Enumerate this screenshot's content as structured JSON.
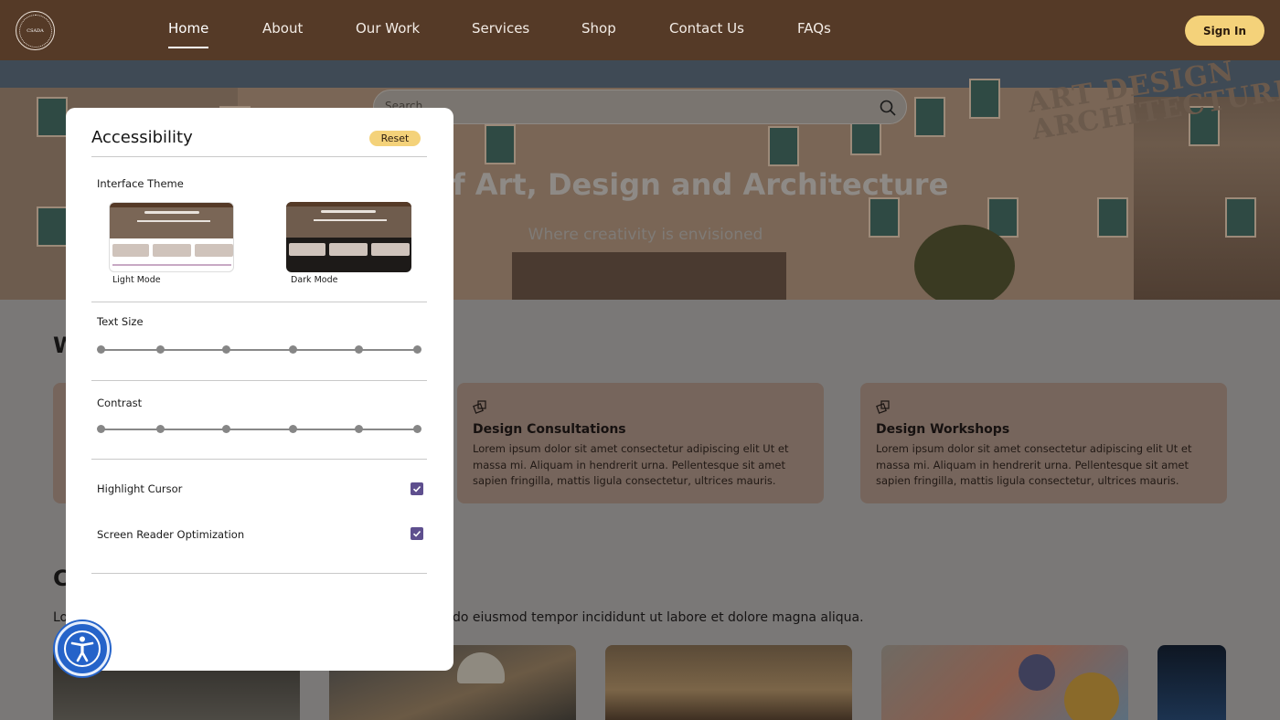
{
  "nav": {
    "logo_text": "CSADA",
    "links": [
      "Home",
      "About",
      "Our Work",
      "Services",
      "Shop",
      "Contact Us",
      "FAQs"
    ],
    "active": "Home",
    "signin_label": "Sign In"
  },
  "hero": {
    "search_placeholder": "Search",
    "sign_text_line1": "ART DESIGN",
    "sign_text_line2": "ARCHITECTURE",
    "title": "ctory of Art, Design and Architecture",
    "subtitle": "Where creativity is envisioned"
  },
  "content": {
    "section_heading_fragment": "W",
    "cards": [
      {
        "title": "Design Consultations",
        "text": "Lorem ipsum dolor sit amet consectetur adipiscing elit Ut et massa mi. Aliquam in hendrerit urna. Pellentesque sit amet sapien fringilla, mattis ligula consectetur, ultrices mauris."
      },
      {
        "title": "Design Workshops",
        "text": "Lorem ipsum dolor sit amet consectetur adipiscing elit Ut et massa mi. Aliquam in hendrerit urna. Pellentesque sit amet sapien fringilla, mattis ligula consectetur, ultrices mauris."
      }
    ],
    "section2_heading_fragment": "C",
    "lorem_lead": "Lo",
    "lorem_tail": "do eiusmod tempor incididunt ut labore et dolore magna aliqua."
  },
  "accessibility": {
    "title": "Accessibility",
    "reset_label": "Reset",
    "theme_label": "Interface Theme",
    "light_label": "Light Mode",
    "dark_label": "Dark Mode",
    "text_size_label": "Text Size",
    "contrast_label": "Contrast",
    "highlight_cursor_label": "Highlight Cursor",
    "highlight_cursor_checked": true,
    "screen_reader_label": "Screen Reader Optimization",
    "screen_reader_checked": true
  },
  "colors": {
    "nav_bg": "#553a27",
    "accent_yellow": "#f4d27a",
    "checkbox": "#5e4f8e",
    "a11y_button": "#2563c9"
  }
}
